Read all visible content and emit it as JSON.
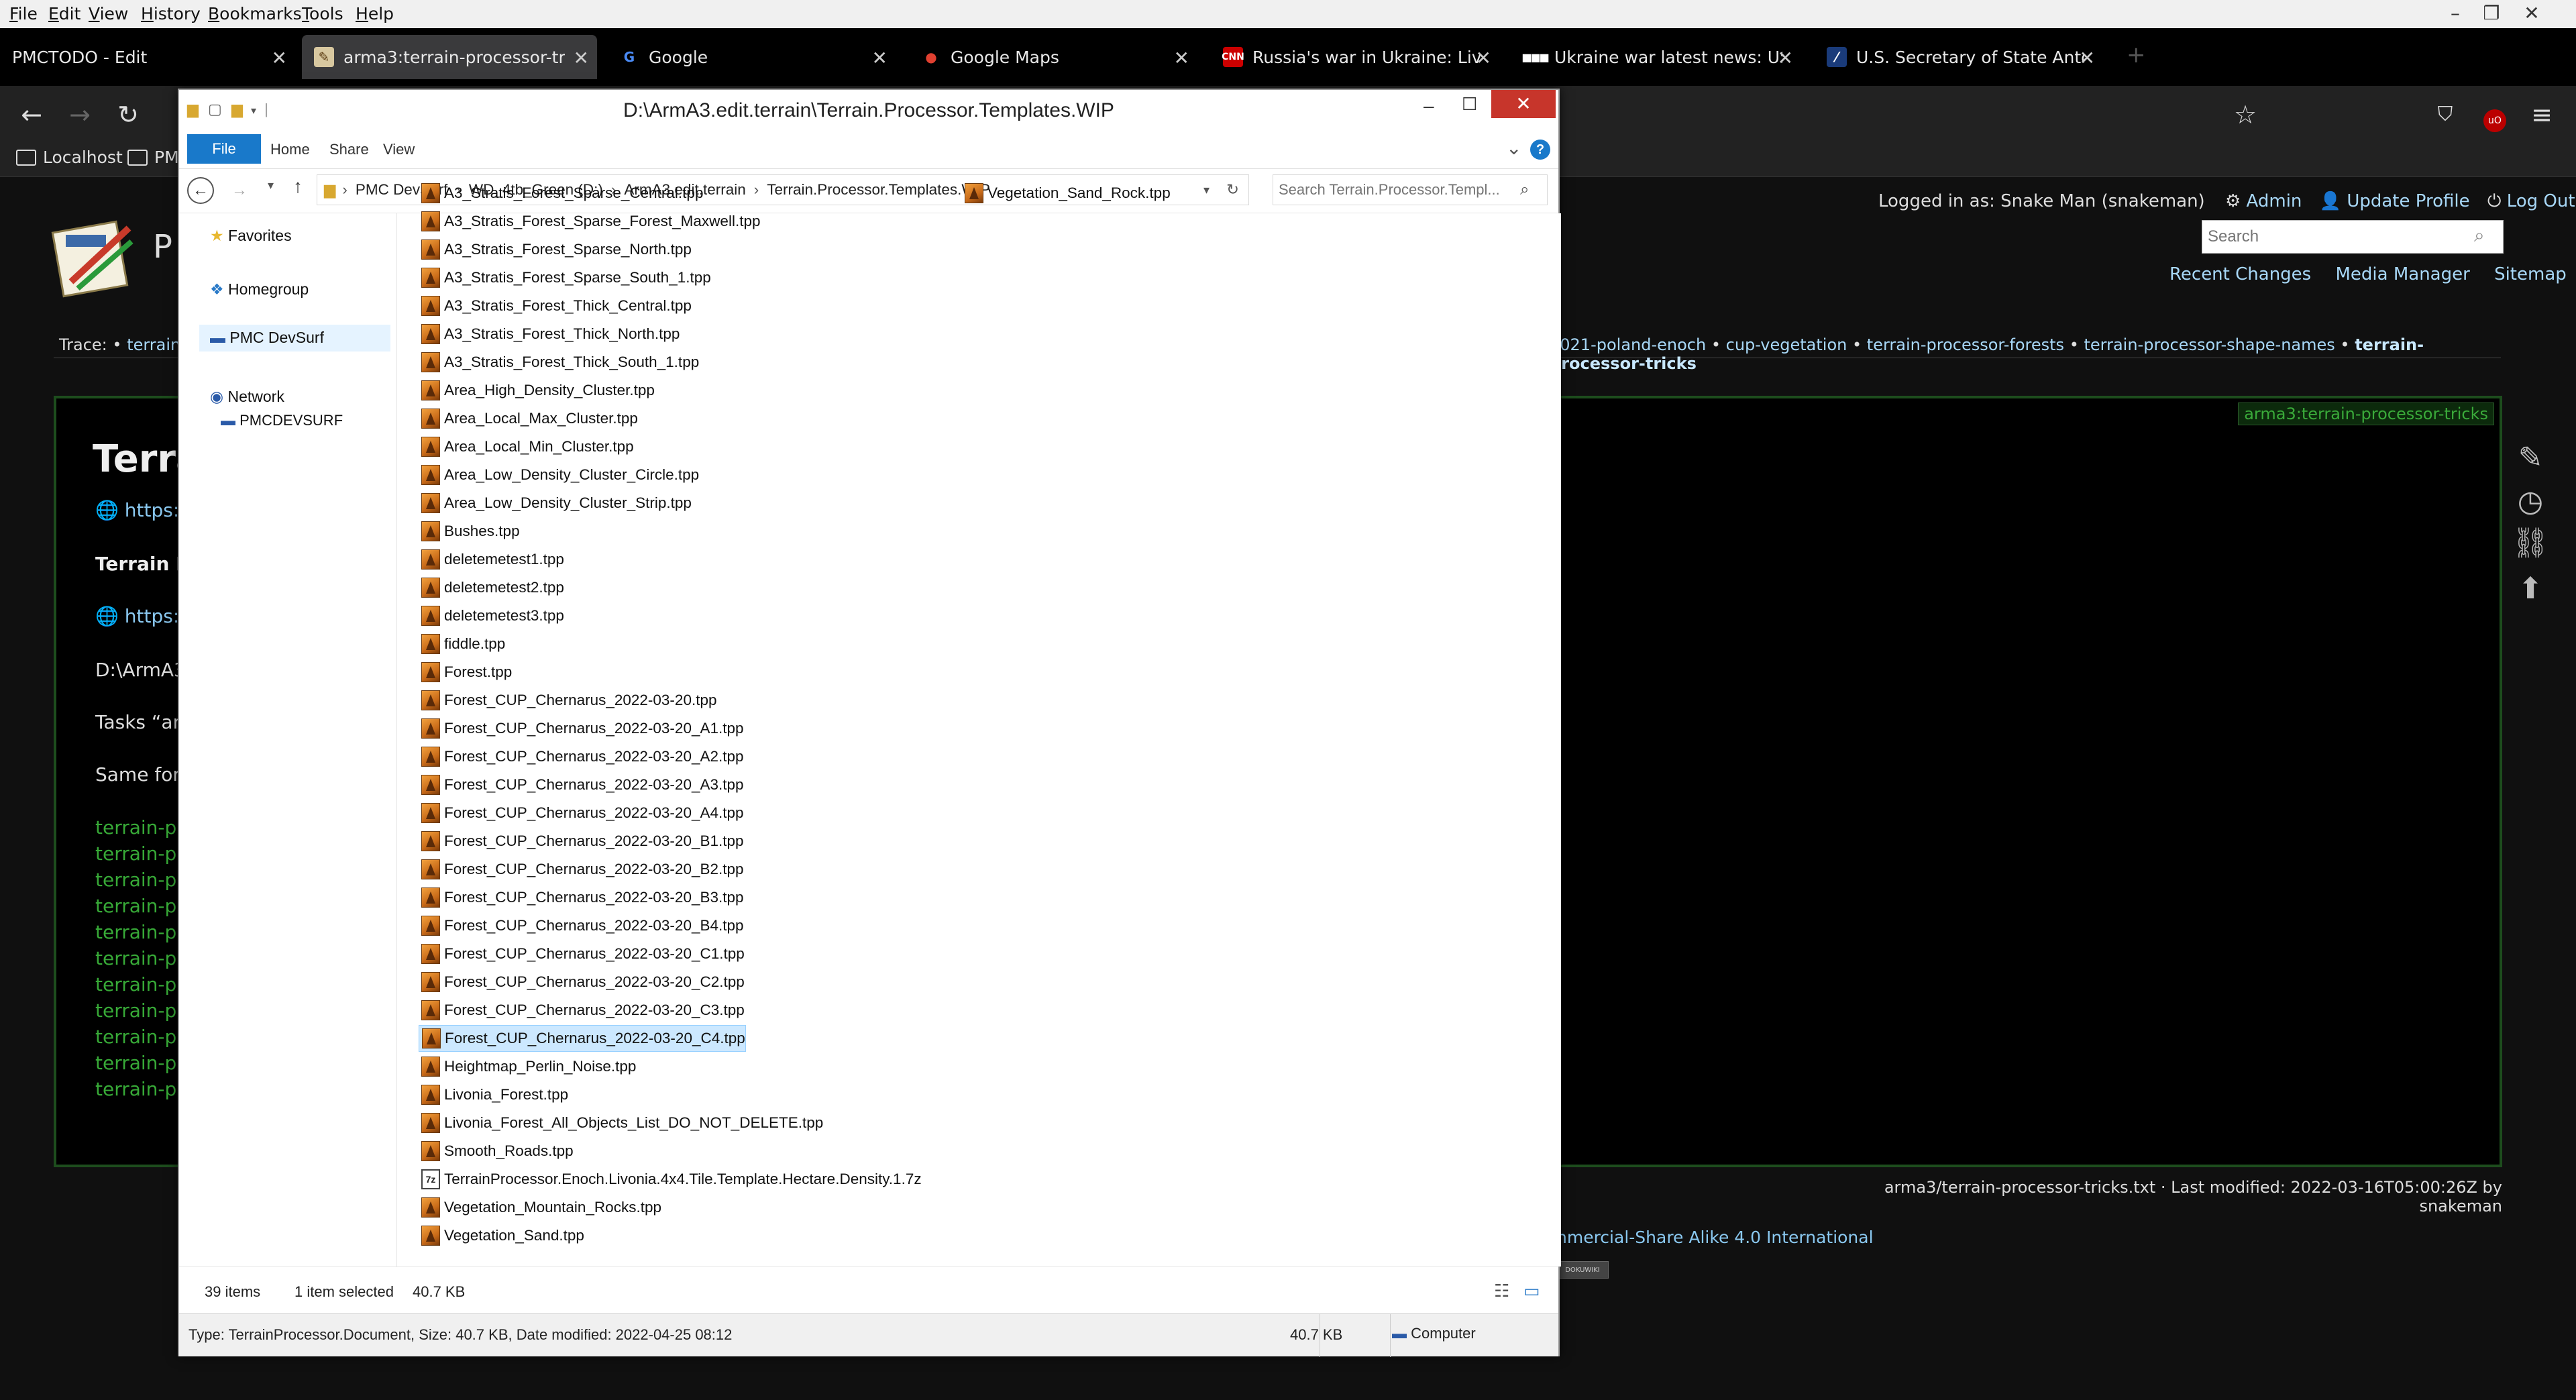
{
  "menubar": {
    "items": [
      "File",
      "Edit",
      "View",
      "History",
      "Bookmarks",
      "Tools",
      "Help"
    ]
  },
  "tabs": [
    {
      "label": "PMCTODO - Edit",
      "icon": "none"
    },
    {
      "label": "arma3:terrain-processor-tricks [P",
      "icon": "wiki-icon"
    },
    {
      "label": "Google",
      "icon": "google-icon"
    },
    {
      "label": "Google Maps",
      "icon": "maps-pin-icon"
    },
    {
      "label": "Russia's war in Ukraine: Live upd",
      "icon": "cnn-icon"
    },
    {
      "label": "Ukraine war latest news: US con",
      "icon": "dots-icon"
    },
    {
      "label": "U.S. Secretary of State Antony B",
      "icon": "state-dept-icon"
    }
  ],
  "bookmarks": [
    "Localhost",
    "PM"
  ],
  "wiki": {
    "logged_in_label": "Logged in as: Snake Man (snakeman)",
    "admin": "Admin",
    "update_profile": "Update Profile",
    "logout": "Log Out",
    "search_placeholder": "Search",
    "recent_changes": "Recent Changes",
    "media_manager": "Media Manager",
    "sitemap": "Sitemap",
    "logo_partial": "P",
    "trace_label": "Trace:",
    "trace_first": "terrain-p",
    "trace_tail": [
      "2021-poland-enoch",
      "cup-vegetation",
      "terrain-processor-forests",
      "terrain-processor-shape-names"
    ],
    "trace_current": "terrain-processor-tricks",
    "page_tag": "arma3:terrain-processor-tricks",
    "heading_partial": "Terra",
    "link1_partial": "https://",
    "bold_partial": "Terrain Pr",
    "link2_partial": "https://",
    "path_partial": "D:\\ArmA3.",
    "tasks_partial": "Tasks “are",
    "same_partial": "Same for “",
    "green_links_partial": "terrain-pro",
    "green_links_count": 11,
    "footer_modified": "arma3/terrain-processor-tricks.txt · Last modified: 2022-03-16T05:00:26Z by snakeman",
    "license_partial": "nmercial-Share Alike 4.0 International",
    "badge_partial": "DOKUWIKI"
  },
  "explorer": {
    "title": "D:\\ArmA3.edit.terrain\\Terrain.Processor.Templates.WIP",
    "ribbon": {
      "file": "File",
      "home": "Home",
      "share": "Share",
      "view": "View"
    },
    "breadcrumb": [
      "PMC DevSurf",
      "WD_4tb_Green (D:)",
      "ArmA3.edit.terrain",
      "Terrain.Processor.Templates.WIP"
    ],
    "search_placeholder": "Search Terrain.Processor.Templ...",
    "nav": {
      "favorites": "Favorites",
      "homegroup": "Homegroup",
      "this_pc": "PMC DevSurf",
      "network": "Network",
      "network_child": "PMCDEVSURF"
    },
    "files_col1": [
      "A3_Stratis_Forest_Sparse_Central.tpp",
      "A3_Stratis_Forest_Sparse_Forest_Maxwell.tpp",
      "A3_Stratis_Forest_Sparse_North.tpp",
      "A3_Stratis_Forest_Sparse_South_1.tpp",
      "A3_Stratis_Forest_Thick_Central.tpp",
      "A3_Stratis_Forest_Thick_North.tpp",
      "A3_Stratis_Forest_Thick_South_1.tpp",
      "Area_High_Density_Cluster.tpp",
      "Area_Local_Max_Cluster.tpp",
      "Area_Local_Min_Cluster.tpp",
      "Area_Low_Density_Cluster_Circle.tpp",
      "Area_Low_Density_Cluster_Strip.tpp",
      "Bushes.tpp",
      "deletemetest1.tpp",
      "deletemetest2.tpp",
      "deletemetest3.tpp",
      "fiddle.tpp",
      "Forest.tpp",
      "Forest_CUP_Chernarus_2022-03-20.tpp",
      "Forest_CUP_Chernarus_2022-03-20_A1.tpp",
      "Forest_CUP_Chernarus_2022-03-20_A2.tpp",
      "Forest_CUP_Chernarus_2022-03-20_A3.tpp",
      "Forest_CUP_Chernarus_2022-03-20_A4.tpp",
      "Forest_CUP_Chernarus_2022-03-20_B1.tpp",
      "Forest_CUP_Chernarus_2022-03-20_B2.tpp",
      "Forest_CUP_Chernarus_2022-03-20_B3.tpp",
      "Forest_CUP_Chernarus_2022-03-20_B4.tpp",
      "Forest_CUP_Chernarus_2022-03-20_C1.tpp",
      "Forest_CUP_Chernarus_2022-03-20_C2.tpp",
      "Forest_CUP_Chernarus_2022-03-20_C3.tpp",
      "Forest_CUP_Chernarus_2022-03-20_C4.tpp",
      "Heightmap_Perlin_Noise.tpp",
      "Livonia_Forest.tpp",
      "Livonia_Forest_All_Objects_List_DO_NOT_DELETE.tpp",
      "Smooth_Roads.tpp",
      "TerrainProcessor.Enoch.Livonia.4x4.Tile.Template.Hectare.Density.1.7z",
      "Vegetation_Mountain_Rocks.tpp",
      "Vegetation_Sand.tpp"
    ],
    "files_col2": [
      "Vegetation_Sand_Rock.tpp"
    ],
    "selected_file": "Forest_CUP_Chernarus_2022-03-20_C4.tpp",
    "status": {
      "items": "39 items",
      "selected": "1 item selected",
      "size": "40.7 KB"
    },
    "detail": {
      "type_line": "Type: TerrainProcessor.Document, Size: 40.7 KB, Date modified: 2022-04-25 08:12",
      "size": "40.7 KB",
      "location": "Computer"
    }
  }
}
